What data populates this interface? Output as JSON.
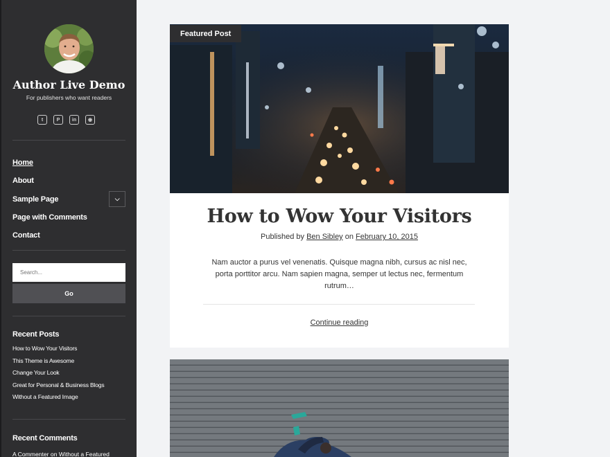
{
  "sidebar": {
    "site_title": "Author Live Demo",
    "tagline": "For publishers who want readers",
    "social_icons": [
      "twitter-icon",
      "pinterest-icon",
      "linkedin-icon",
      "instagram-icon"
    ],
    "nav": [
      {
        "label": "Home",
        "current": true
      },
      {
        "label": "About"
      },
      {
        "label": "Sample Page",
        "has_submenu": true
      },
      {
        "label": "Page with Comments"
      },
      {
        "label": "Contact"
      }
    ],
    "search": {
      "placeholder": "Search...",
      "button": "Go"
    },
    "recent_posts_title": "Recent Posts",
    "recent_posts": [
      "How to Wow Your Visitors",
      "This Theme is Awesome",
      "Change Your Look",
      "Great for Personal & Business Blogs",
      "Without a Featured Image"
    ],
    "recent_comments_title": "Recent Comments",
    "recent_comment": "A Commenter on Without a Featured"
  },
  "post": {
    "featured_label": "Featured Post",
    "title": "How to Wow Your Visitors",
    "byline_prefix": "Published by",
    "author": "Ben Sibley",
    "byline_mid": "on",
    "date": "February 10, 2015",
    "excerpt": "Nam auctor a purus vel venenatis. Quisque magna nibh, cursus ac nisl nec, porta porttitor arcu. Nam sapien magna, semper ut lectus nec, fermentum rutrum…",
    "continue": "Continue reading"
  },
  "colors": {
    "sidebar_bg": "#2e2e30",
    "page_bg": "#f2f3f5",
    "button_bg": "#505054"
  }
}
